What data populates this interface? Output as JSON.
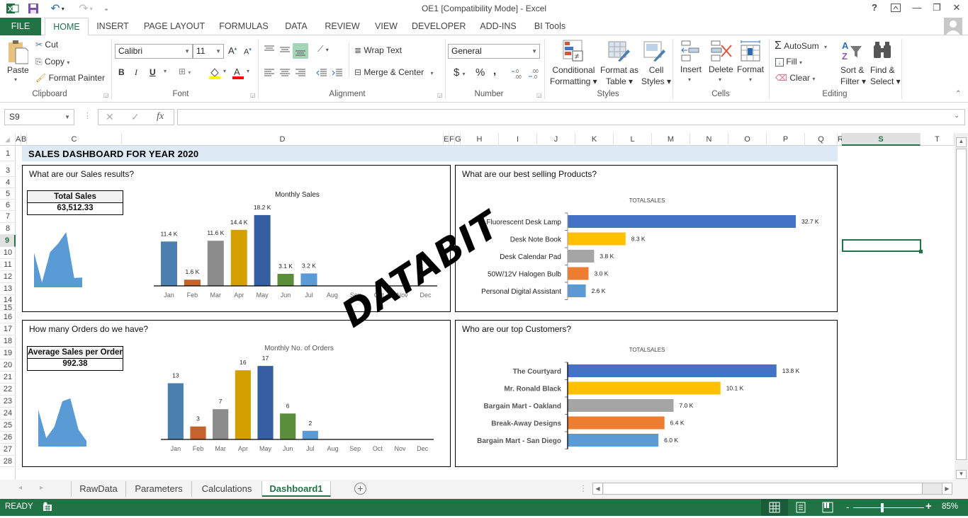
{
  "window": {
    "title": "OE1  [Compatibility Mode] - Excel",
    "quick_access": [
      "excel-logo",
      "save",
      "undo",
      "redo",
      "customize"
    ],
    "controls": {
      "help": "?",
      "restore_ribbon": "⇱",
      "minimize": "—",
      "restore": "❐",
      "close": "✕"
    }
  },
  "ribbon_tabs": [
    "FILE",
    "HOME",
    "INSERT",
    "PAGE LAYOUT",
    "FORMULAS",
    "DATA",
    "REVIEW",
    "VIEW",
    "DEVELOPER",
    "ADD-INS",
    "BI Tools"
  ],
  "active_tab": "HOME",
  "ribbon": {
    "clipboard": {
      "paste": "Paste",
      "cut": "Cut",
      "copy": "Copy",
      "format_painter": "Format Painter",
      "label": "Clipboard"
    },
    "font": {
      "name": "Calibri",
      "size": "11",
      "bold": "B",
      "italic": "I",
      "underline": "U",
      "label": "Font"
    },
    "alignment": {
      "wrap": "Wrap Text",
      "merge": "Merge & Center",
      "label": "Alignment"
    },
    "number": {
      "format": "General",
      "currency": "$",
      "percent": "%",
      "comma": ",",
      "inc_decimal": "←.0 .00",
      "dec_decimal": ".00 →.0",
      "label": "Number"
    },
    "styles": {
      "conditional": [
        "Conditional",
        "Formatting ▾"
      ],
      "format_table": [
        "Format as",
        "Table ▾"
      ],
      "cell_styles": [
        "Cell",
        "Styles ▾"
      ],
      "label": "Styles"
    },
    "cells": {
      "insert": "Insert",
      "delete": "Delete",
      "format": "Format",
      "label": "Cells"
    },
    "editing": {
      "autosum": "AutoSum",
      "fill": "Fill",
      "clear": "Clear",
      "sort": [
        "Sort &",
        "Filter ▾"
      ],
      "find": [
        "Find &",
        "Select ▾"
      ],
      "label": "Editing"
    }
  },
  "formula_bar": {
    "name_box": "S9",
    "cancel": "✕",
    "enter": "✓",
    "fx": "fx",
    "value": ""
  },
  "columns": [
    "A",
    "B",
    "C",
    "D",
    "E",
    "F",
    "G",
    "H",
    "I",
    "J",
    "K",
    "L",
    "M",
    "N",
    "O",
    "P",
    "Q",
    "R",
    "S",
    "T"
  ],
  "selected_column": "S",
  "rows": [
    "1",
    "3",
    "4",
    "5",
    "6",
    "7",
    "8",
    "9",
    "10",
    "11",
    "12",
    "13",
    "14",
    "15",
    "16",
    "17",
    "18",
    "19",
    "20",
    "21",
    "22",
    "23",
    "24",
    "25",
    "26",
    "27",
    "28"
  ],
  "selected_row": "9",
  "dashboard": {
    "title": "SALES DASHBOARD FOR YEAR 2020",
    "watermark": "DATABIT",
    "sales_panel": {
      "question": "What are our Sales results?",
      "kpi_label": "Total Sales",
      "kpi_value": "63,512.33"
    },
    "orders_panel": {
      "question": "How many Orders do we have?",
      "kpi_label": "Average Sales per Order",
      "kpi_value": "992.38"
    },
    "products_panel": {
      "question": "What are our best selling Products?"
    },
    "customers_panel": {
      "question": "Who are our top Customers?"
    }
  },
  "chart_data": [
    {
      "id": "monthly-sales",
      "type": "bar",
      "title": "Monthly Sales",
      "categories": [
        "Jan",
        "Feb",
        "Mar",
        "Apr",
        "May",
        "Jun",
        "Jul",
        "Aug",
        "Sep",
        "Oct",
        "Nov",
        "Dec"
      ],
      "values": [
        11.4,
        1.6,
        11.6,
        14.4,
        18.2,
        3.1,
        3.2,
        null,
        null,
        null,
        null,
        null
      ],
      "labels": [
        "11.4 K",
        "1.6 K",
        "11.6 K",
        "14.4 K",
        "18.2 K",
        "3.1 K",
        "3.2 K",
        "",
        "",
        "",
        "",
        ""
      ],
      "colors": [
        "#4a7fb0",
        "#c5632c",
        "#8c8c8c",
        "#d4a000",
        "#365ea3",
        "#5b8e3a",
        "#5b9bd5"
      ],
      "unit": "K",
      "ylim": [
        0,
        20
      ],
      "grid": false
    },
    {
      "id": "monthly-orders",
      "type": "bar",
      "title": "Monthly No. of Orders",
      "categories": [
        "Jan",
        "Feb",
        "Mar",
        "Apr",
        "May",
        "Jun",
        "Jul",
        "Aug",
        "Sep",
        "Oct",
        "Nov",
        "Dec"
      ],
      "values": [
        13,
        3,
        7,
        16,
        17,
        6,
        2,
        null,
        null,
        null,
        null,
        null
      ],
      "labels": [
        "13",
        "3",
        "7",
        "16",
        "17",
        "6",
        "2",
        "",
        "",
        "",
        "",
        ""
      ],
      "colors": [
        "#4a7fb0",
        "#c5632c",
        "#8c8c8c",
        "#d4a000",
        "#365ea3",
        "#5b8e3a",
        "#5b9bd5"
      ],
      "ylim": [
        0,
        18
      ],
      "grid": false
    },
    {
      "id": "top-products",
      "type": "bar",
      "orientation": "horizontal",
      "title": "TOTALSALES",
      "categories": [
        "Fluorescent Desk Lamp",
        "Desk Note Book",
        "Desk Calendar Pad",
        "50W/12V Halogen Bulb",
        "Personal  Digital Assistant"
      ],
      "values": [
        32.7,
        8.3,
        3.8,
        3.0,
        2.6
      ],
      "labels": [
        "32.7 K",
        "8.3 K",
        "3.8 K",
        "3.0 K",
        "2.6 K"
      ],
      "colors": [
        "#4472c4",
        "#ffc000",
        "#a5a5a5",
        "#ed7d31",
        "#5b9bd5"
      ],
      "unit": "K",
      "xlim": [
        0,
        33
      ]
    },
    {
      "id": "top-customers",
      "type": "bar",
      "orientation": "horizontal",
      "title": "TOTALSALES",
      "categories": [
        "The Courtyard",
        "Mr. Ronald Black",
        "Bargain Mart - Oakland",
        "Break-Away Designs",
        "Bargain Mart - San Diego"
      ],
      "values": [
        13.8,
        10.1,
        7.0,
        6.4,
        6.0
      ],
      "labels": [
        "13.8 K",
        "10.1 K",
        "7.0 K",
        "6.4 K",
        "6.0 K"
      ],
      "colors": [
        "#4472c4",
        "#ffc000",
        "#a5a5a5",
        "#ed7d31",
        "#5b9bd5"
      ],
      "unit": "K",
      "xlim": [
        0,
        14
      ]
    },
    {
      "id": "sales-sparkline",
      "type": "area",
      "values": [
        11.4,
        1.6,
        11.6,
        14.4,
        18.2,
        3.1,
        3.2
      ],
      "color": "#5b9bd5"
    },
    {
      "id": "orders-sparkline",
      "type": "area",
      "values": [
        13,
        3,
        7,
        16,
        17,
        6,
        2
      ],
      "color": "#5b9bd5"
    }
  ],
  "sheet_tabs": [
    "RawData",
    "Parameters",
    "Calculations",
    "Dashboard1"
  ],
  "active_sheet": "Dashboard1",
  "status": {
    "mode": "READY",
    "zoom": "85%",
    "zoom_fraction": 0.42
  }
}
